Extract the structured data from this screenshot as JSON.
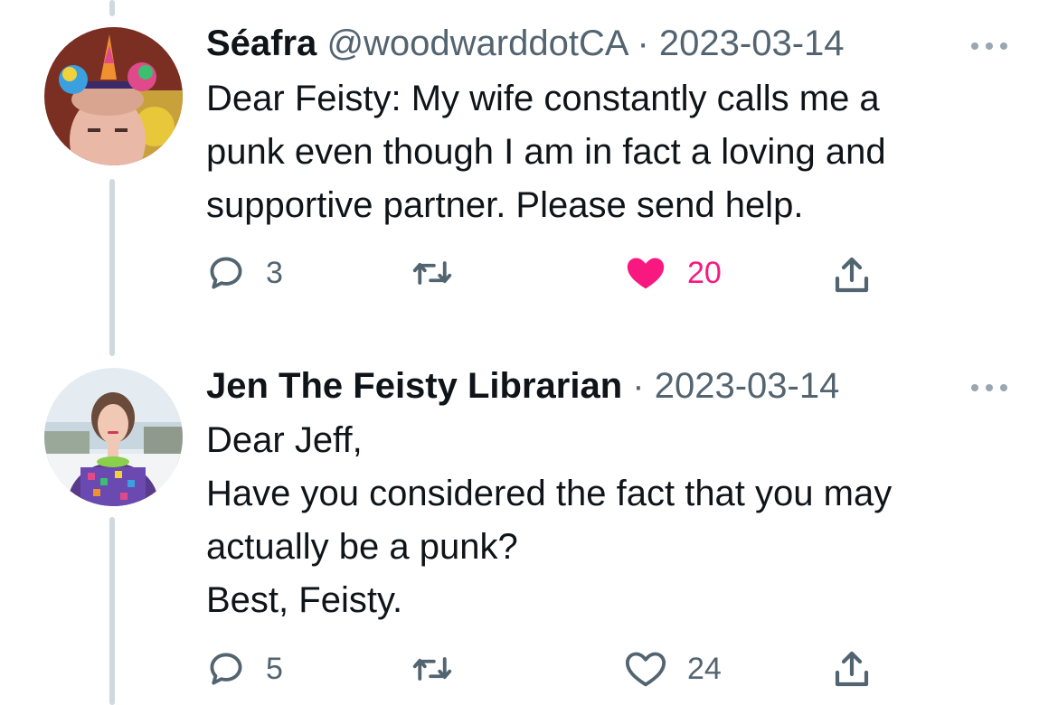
{
  "tweets": [
    {
      "display_name": "Séafra",
      "handle": "@woodwarddotCA",
      "separator": "·",
      "date": "2023-03-14",
      "lines": [
        "Dear Feisty: My wife constantly calls me a",
        "punk even though I am in fact a loving and",
        "supportive partner. Please send help."
      ],
      "replies": "3",
      "likes": "20",
      "liked": true
    },
    {
      "display_name": "Jen The Feisty Librarian",
      "separator": "·",
      "date": "2023-03-14",
      "lines": [
        "Dear Jeff,",
        "Have you considered the fact that you may",
        "actually be a punk?",
        "Best, Feisty."
      ],
      "replies": "5",
      "likes": "24",
      "liked": false
    }
  ],
  "icons": [
    "reply-icon",
    "retweet-icon",
    "like-icon",
    "share-icon",
    "more-icon"
  ],
  "colors": {
    "like_active": "#f91880",
    "meta": "#536471",
    "thread_line": "#cfd9de"
  }
}
